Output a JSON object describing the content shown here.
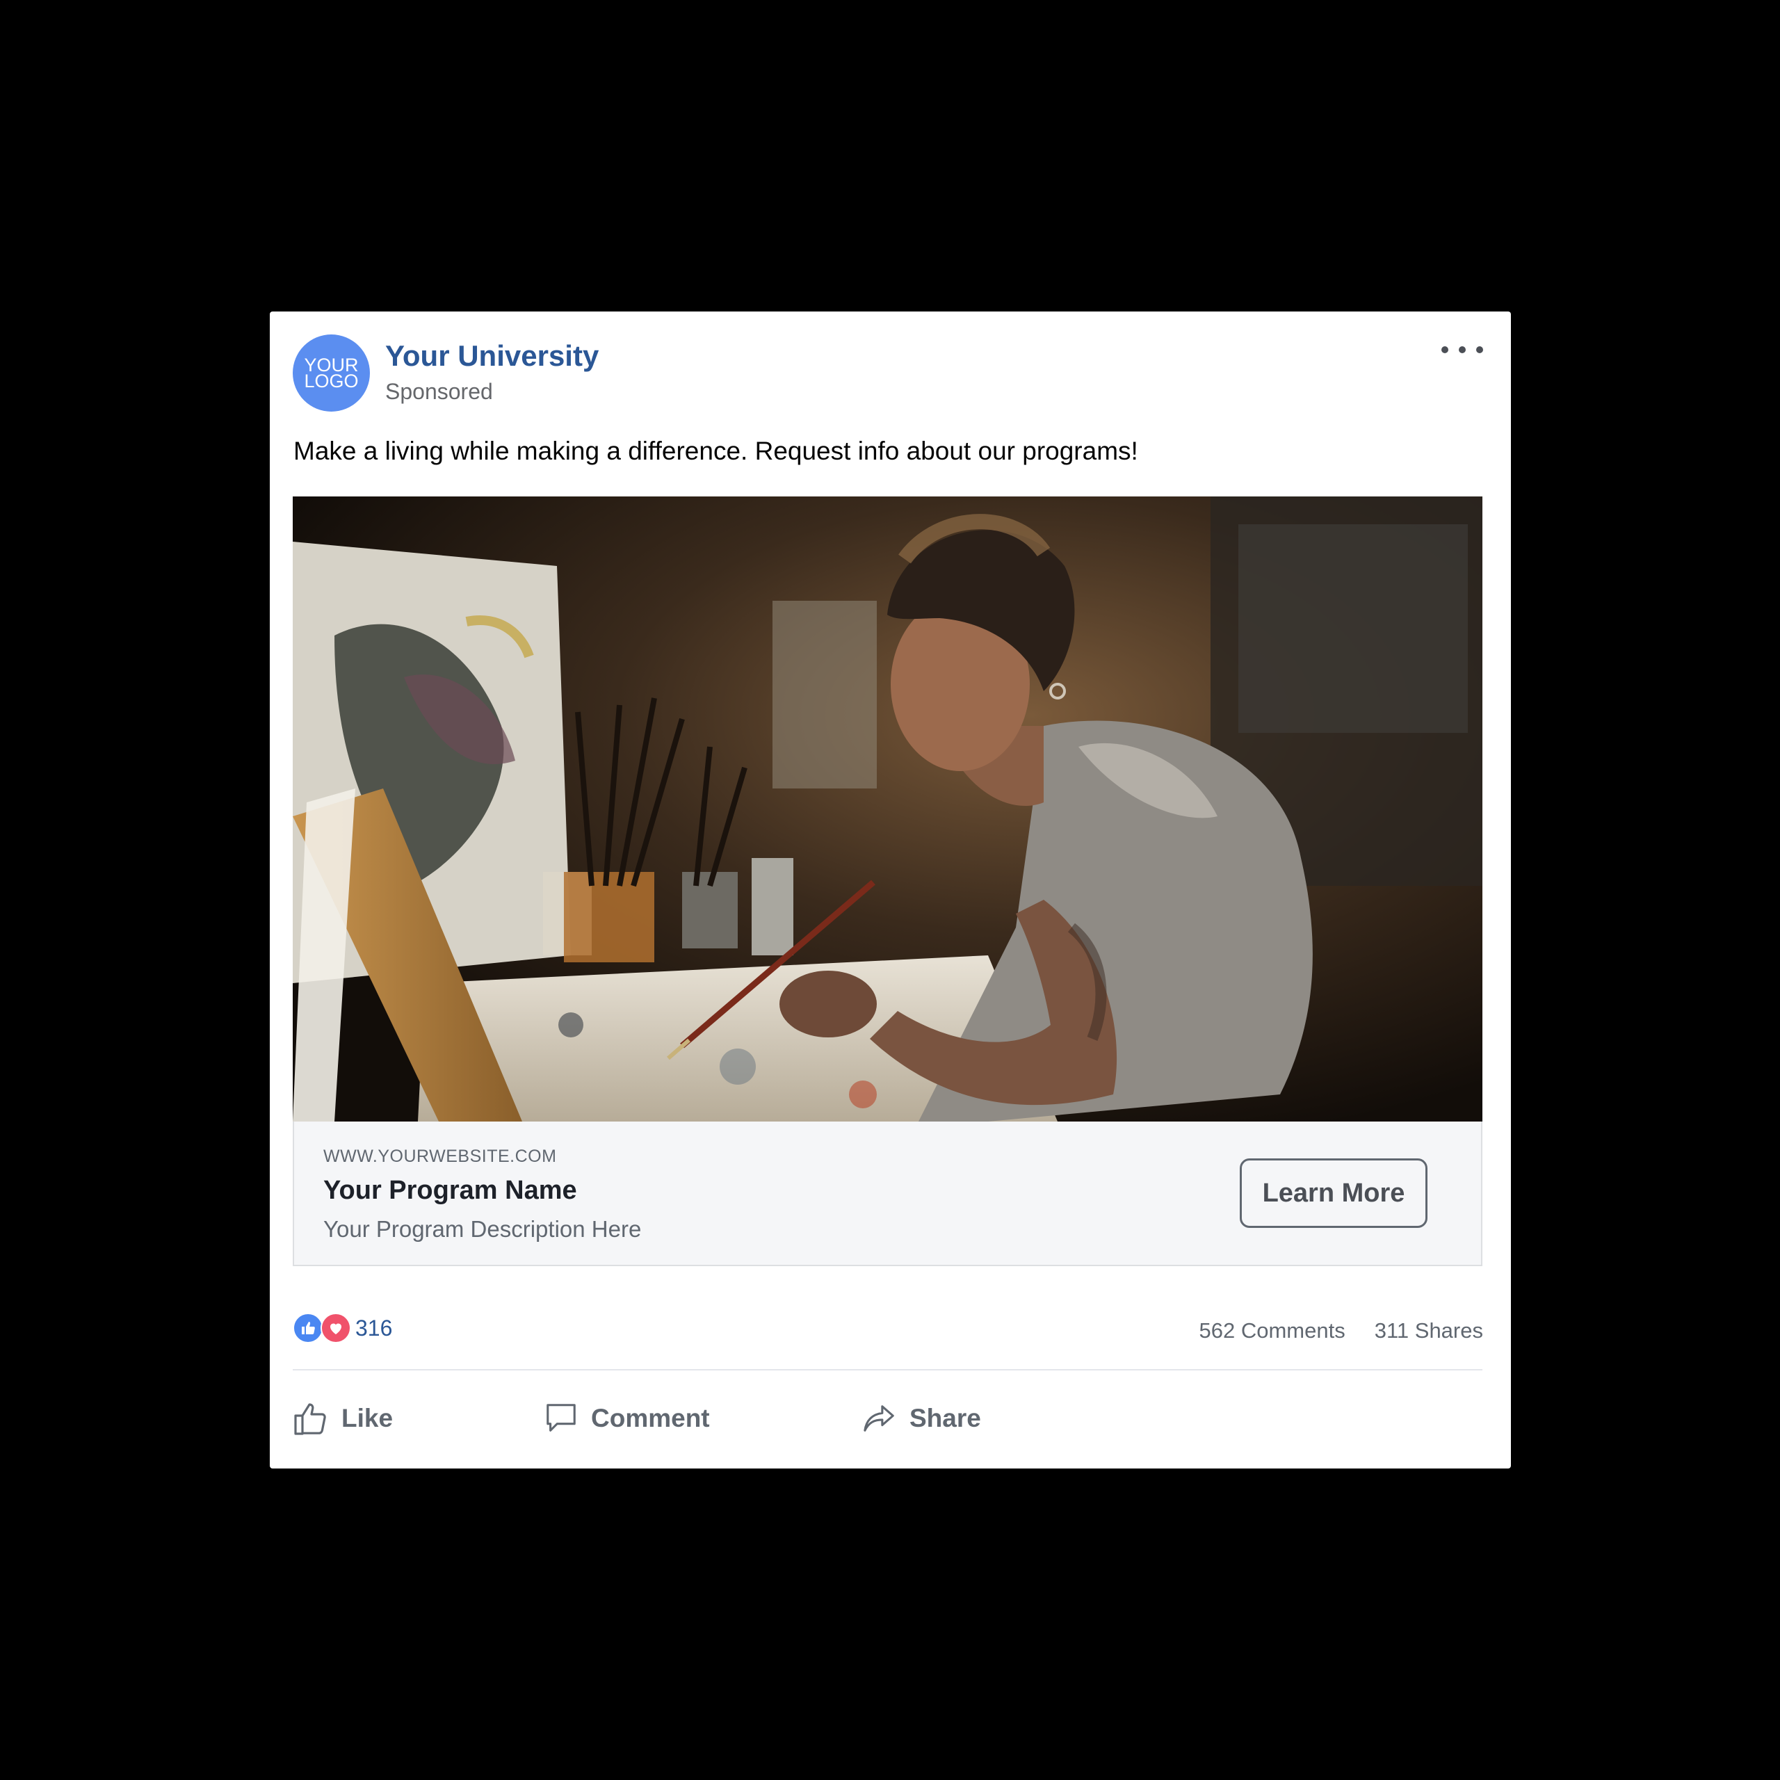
{
  "header": {
    "logo_text": "YOUR\nLOGO",
    "page_name": "Your University",
    "sponsored": "Sponsored"
  },
  "post": {
    "message": "Make a living while making a difference. Request info about our programs!"
  },
  "link_card": {
    "url": "WWW.YOURWEBSITE.COM",
    "title": "Your Program Name",
    "description": "Your Program Description Here",
    "cta_label": "Learn More"
  },
  "engagement": {
    "reaction_count": "316",
    "comments": "562 Comments",
    "shares": "311 Shares"
  },
  "actions": {
    "like": "Like",
    "comment": "Comment",
    "share": "Share"
  },
  "colors": {
    "brand_blue": "#2b5796",
    "avatar_blue": "#5b8ef0",
    "like_blue": "#4a87f2",
    "love_red": "#f0526b"
  },
  "icons": [
    "more-options-icon",
    "like-reaction-icon",
    "love-reaction-icon",
    "thumbs-up-icon",
    "speech-bubble-icon",
    "share-arrow-icon"
  ]
}
